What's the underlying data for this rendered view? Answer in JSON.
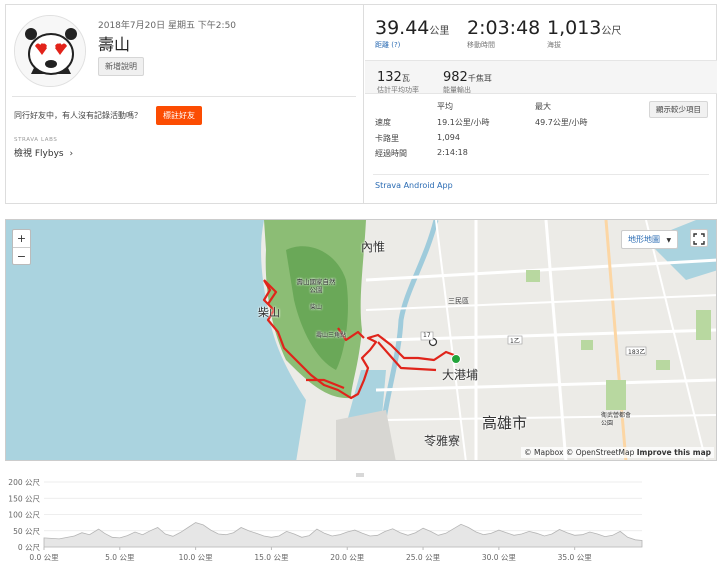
{
  "activity": {
    "date": "2018年7月20日 星期五 下午2:50",
    "title": "壽山",
    "add_description": "新增說明",
    "group_prompt": "同行好友中，有人沒有記錄活動嗎？",
    "tag_friends": "標註好友",
    "labs_label": "STRAVA LABS",
    "flybys_label": "檢視 Flybys"
  },
  "stats": {
    "distance": {
      "value": "39.44",
      "unit": "公里",
      "label": "距離"
    },
    "moving_time": {
      "value": "2:03:48",
      "label": "移動時間"
    },
    "elevation": {
      "value": "1,013",
      "unit": "公尺",
      "label": "海拔"
    },
    "power": {
      "value": "132",
      "unit": "瓦",
      "label": "估計平均功率"
    },
    "energy": {
      "value": "982",
      "unit": "千焦耳",
      "label": "能量輸出"
    },
    "help_icon": "(?)"
  },
  "details": {
    "col_avg": "平均",
    "col_max": "最大",
    "show_less": "顯示較少項目",
    "rows": [
      {
        "label": "速度",
        "avg": "19.1公里/小時",
        "max": "49.7公里/小時"
      },
      {
        "label": "卡路里",
        "avg": "1,094",
        "max": ""
      },
      {
        "label": "經過時間",
        "avg": "2:14:18",
        "max": ""
      }
    ],
    "app_link": "Strava Android App"
  },
  "map": {
    "zoom_in": "+",
    "zoom_out": "−",
    "terrain_button": "地形地圖",
    "attribution_mapbox": "© Mapbox",
    "attribution_osm": "© OpenStreetMap",
    "attribution_improve": "Improve this map",
    "labels": {
      "neiwei": "內惟",
      "chaishan": "柴山",
      "park": "壽山國家自然公園",
      "park_sub": "柴山",
      "peak": "壽山三角點",
      "sanmin": "三民區",
      "dagangpu": "大港埔",
      "kaohsiung": "高雄市",
      "lingyaliao": "苓雅寮",
      "road_17": "17",
      "road_1b": "1乙",
      "road_183": "183乙",
      "school": "衛武營都會公園"
    },
    "colors": {
      "route": "#e0241b",
      "sea": "#aad3df",
      "park": "#7cb36a",
      "end": "#22a33a"
    }
  },
  "elevation_chart": {
    "y_ticks": [
      "200 公尺",
      "150 公尺",
      "100 公尺",
      "50 公尺",
      "0 公尺"
    ],
    "x_ticks": [
      "0.0 公里",
      "5.0 公里",
      "10.0 公里",
      "15.0 公里",
      "20.0 公里",
      "25.0 公里",
      "30.0 公里",
      "35.0 公里"
    ],
    "unit_x": "km",
    "unit_y": "m",
    "x_max": 39.44,
    "y_max": 200,
    "profile": [
      [
        0,
        28
      ],
      [
        1,
        25
      ],
      [
        2,
        34
      ],
      [
        2.5,
        44
      ],
      [
        3,
        38
      ],
      [
        3.6,
        55
      ],
      [
        4,
        42
      ],
      [
        4.5,
        30
      ],
      [
        5,
        28
      ],
      [
        5.5,
        35
      ],
      [
        6,
        46
      ],
      [
        6.5,
        38
      ],
      [
        7,
        50
      ],
      [
        7.5,
        60
      ],
      [
        8,
        40
      ],
      [
        8.5,
        33
      ],
      [
        9,
        45
      ],
      [
        9.5,
        60
      ],
      [
        10,
        75
      ],
      [
        10.5,
        68
      ],
      [
        11,
        52
      ],
      [
        11.5,
        40
      ],
      [
        12,
        38
      ],
      [
        12.5,
        44
      ],
      [
        13,
        60
      ],
      [
        13.5,
        50
      ],
      [
        14,
        42
      ],
      [
        14.5,
        34
      ],
      [
        15,
        30
      ],
      [
        15.5,
        34
      ],
      [
        16,
        48
      ],
      [
        16.5,
        40
      ],
      [
        17,
        30
      ],
      [
        17.5,
        35
      ],
      [
        18,
        55
      ],
      [
        18.5,
        42
      ],
      [
        19,
        34
      ],
      [
        19.5,
        38
      ],
      [
        20,
        46
      ],
      [
        20.5,
        52
      ],
      [
        21,
        42
      ],
      [
        21.5,
        34
      ],
      [
        22,
        36
      ],
      [
        22.5,
        48
      ],
      [
        23,
        56
      ],
      [
        23.5,
        44
      ],
      [
        24,
        36
      ],
      [
        24.5,
        44
      ],
      [
        25,
        58
      ],
      [
        25.5,
        48
      ],
      [
        26,
        36
      ],
      [
        26.5,
        42
      ],
      [
        27,
        56
      ],
      [
        27.5,
        70
      ],
      [
        28,
        60
      ],
      [
        28.5,
        46
      ],
      [
        29,
        38
      ],
      [
        29.5,
        42
      ],
      [
        30,
        52
      ],
      [
        30.5,
        44
      ],
      [
        31,
        36
      ],
      [
        31.5,
        40
      ],
      [
        32,
        48
      ],
      [
        32.5,
        42
      ],
      [
        33,
        34
      ],
      [
        33.5,
        40
      ],
      [
        34,
        54
      ],
      [
        34.5,
        44
      ],
      [
        35,
        36
      ],
      [
        35.5,
        38
      ],
      [
        36,
        46
      ],
      [
        36.5,
        40
      ],
      [
        37,
        32
      ],
      [
        37.5,
        36
      ],
      [
        38,
        48
      ],
      [
        38.5,
        30
      ],
      [
        39,
        22
      ],
      [
        39.44,
        20
      ]
    ]
  }
}
